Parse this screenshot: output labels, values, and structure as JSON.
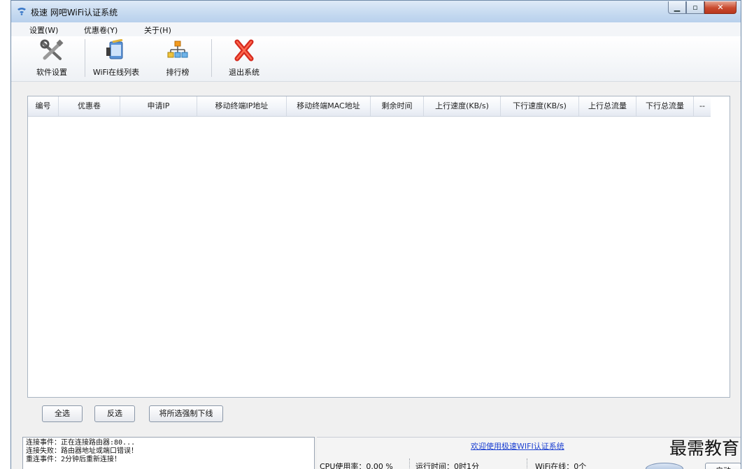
{
  "window": {
    "title": "极速 网吧WiFi认证系统"
  },
  "menu": {
    "items": [
      "设置(W)",
      "优惠卷(Y)",
      "关于(H)"
    ]
  },
  "toolbar": {
    "buttons": [
      {
        "label": "软件设置",
        "icon": "tools-icon"
      },
      {
        "label": "WiFi在线列表",
        "icon": "wifi-list-icon"
      },
      {
        "label": "排行榜",
        "icon": "ranking-icon"
      },
      {
        "label": "退出系统",
        "icon": "exit-icon"
      }
    ]
  },
  "table": {
    "columns": [
      "编号",
      "优惠卷",
      "申请IP",
      "移动终端IP地址",
      "移动终端MAC地址",
      "剩余时间",
      "上行速度(KB/s)",
      "下行速度(KB/s)",
      "上行总流量",
      "下行总流量",
      "--"
    ],
    "rows": []
  },
  "actions": {
    "select_all": "全选",
    "invert": "反选",
    "force_offline": "将所选强制下线"
  },
  "log": {
    "lines": [
      "连接事件：正在连接路由器:80...",
      "连接失败：路由器地址或端口错误！",
      "重连事件：2分钟后重新连接！"
    ]
  },
  "status": {
    "welcome": "欢迎使用极速WIFI认证系统",
    "cpu": "CPU使用率：0.00 %",
    "runtime": "运行时间：0时1分",
    "wifi_online": "WiFi在线：0个",
    "button": "启动"
  },
  "watermark": "最需教育"
}
